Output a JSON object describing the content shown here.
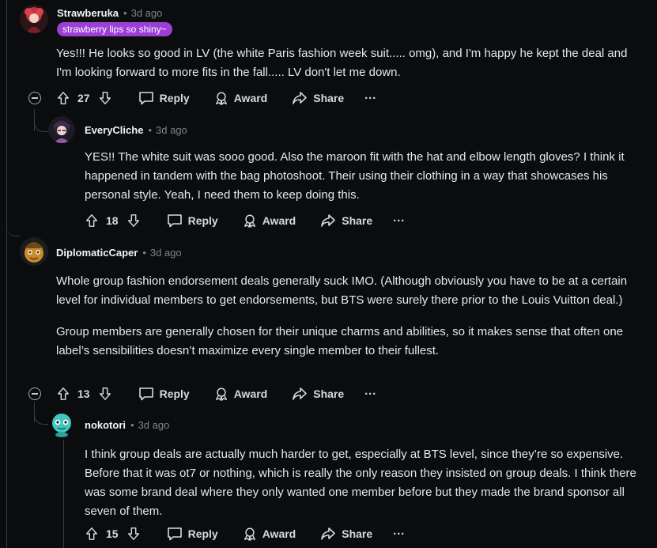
{
  "comments": [
    {
      "username": "Strawberuka",
      "time": "3d ago",
      "flair": "strawberry lips so shiny~",
      "paragraphs": [
        "Yes!!! He looks so good in LV (the white Paris fashion week suit..... omg), and I'm happy he kept the deal and I'm looking forward to more fits in the fall..... LV don't let me down."
      ],
      "score": "27",
      "reply_label": "Reply",
      "award_label": "Award",
      "share_label": "Share",
      "more_label": "···"
    },
    {
      "username": "EveryCliche",
      "time": "3d ago",
      "paragraphs": [
        "YES!! The white suit was sooo good. Also the maroon fit with the hat and elbow length gloves? I think it happened in tandem with the bag photoshoot. Their using their clothing in a way that showcases his personal style. Yeah, I need them to keep doing this."
      ],
      "score": "18",
      "reply_label": "Reply",
      "award_label": "Award",
      "share_label": "Share",
      "more_label": "···"
    },
    {
      "username": "DiplomaticCaper",
      "time": "3d ago",
      "paragraphs": [
        "Whole group fashion endorsement deals generally suck IMO. (Although obviously you have to be at a certain level for individual members to get endorsements, but BTS were surely there prior to the Louis Vuitton deal.)",
        "Group members are generally chosen for their unique charms and abilities, so it makes sense that often one label’s sensibilities doesn’t maximize every single member to their fullest."
      ],
      "score": "13",
      "reply_label": "Reply",
      "award_label": "Award",
      "share_label": "Share",
      "more_label": "···"
    },
    {
      "username": "nokotori",
      "time": "3d ago",
      "paragraphs": [
        "I think group deals are actually much harder to get, especially at BTS level, since they’re so expensive. Before that it was ot7 or nothing, which is really the only reason they insisted on group deals. I think there was some brand deal where they only wanted one member before but they made the brand sponsor all seven of them."
      ],
      "score": "15",
      "reply_label": "Reply",
      "award_label": "Award",
      "share_label": "Share",
      "more_label": "···"
    }
  ],
  "colors": {
    "background": "#0b0c0d",
    "text": "#e6e8ea",
    "muted": "#818384",
    "flair_bg": "#9b3fd6",
    "thread_line": "#3a3c3e"
  },
  "icons": [
    "upvote-icon",
    "downvote-icon",
    "reply-icon",
    "award-icon",
    "share-icon",
    "more-icon",
    "collapse-icon"
  ]
}
